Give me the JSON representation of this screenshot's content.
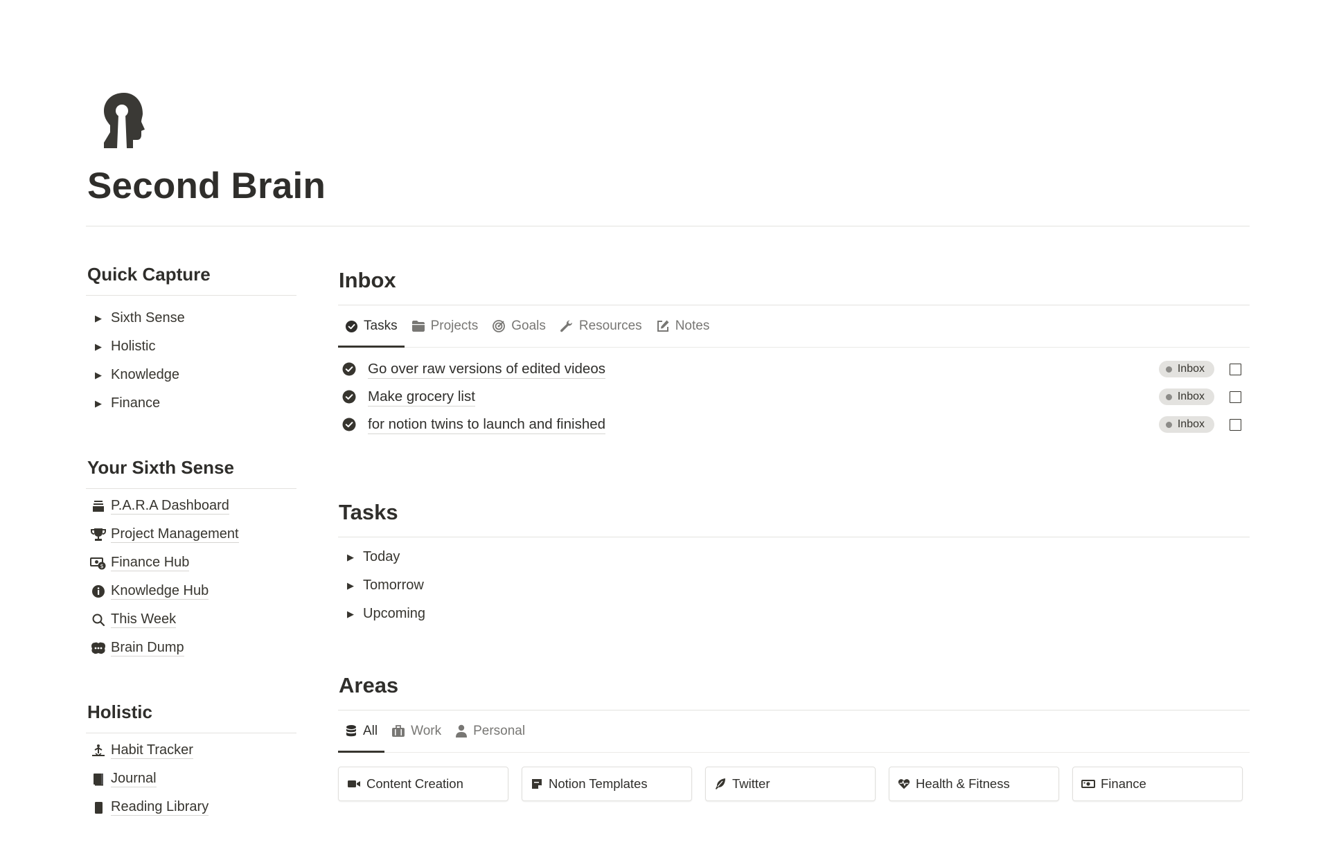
{
  "page": {
    "title": "Second Brain",
    "icon": "head-keyhole-icon"
  },
  "quick_capture": {
    "heading": "Quick Capture",
    "items": [
      {
        "label": "Sixth Sense"
      },
      {
        "label": "Holistic"
      },
      {
        "label": "Knowledge"
      },
      {
        "label": "Finance"
      }
    ]
  },
  "sixth_sense": {
    "heading": "Your Sixth Sense",
    "links": [
      {
        "label": "P.A.R.A Dashboard",
        "icon": "layers-icon"
      },
      {
        "label": "Project Management",
        "icon": "trophy-icon"
      },
      {
        "label": "Finance Hub",
        "icon": "money-icon"
      },
      {
        "label": "Knowledge Hub",
        "icon": "info-icon"
      },
      {
        "label": "This Week",
        "icon": "search-icon"
      },
      {
        "label": "Brain Dump",
        "icon": "brain-icon"
      }
    ]
  },
  "holistic": {
    "heading": "Holistic",
    "links": [
      {
        "label": "Habit Tracker",
        "icon": "habit-icon"
      },
      {
        "label": "Journal",
        "icon": "journal-icon"
      },
      {
        "label": "Reading Library",
        "icon": "bookmark-icon"
      }
    ]
  },
  "inbox": {
    "heading": "Inbox",
    "tabs": [
      {
        "label": "Tasks",
        "icon": "check-circle-icon",
        "active": true
      },
      {
        "label": "Projects",
        "icon": "folder-icon"
      },
      {
        "label": "Goals",
        "icon": "target-icon"
      },
      {
        "label": "Resources",
        "icon": "wrench-icon"
      },
      {
        "label": "Notes",
        "icon": "edit-icon"
      }
    ],
    "tasks": [
      {
        "title": "Go over raw versions of edited videos",
        "status": "Inbox",
        "done": false
      },
      {
        "title": "Make grocery list",
        "status": "Inbox",
        "done": false
      },
      {
        "title": "for notion twins to launch and finished",
        "status": "Inbox",
        "done": false
      }
    ]
  },
  "tasks_section": {
    "heading": "Tasks",
    "items": [
      {
        "label": "Today"
      },
      {
        "label": "Tomorrow"
      },
      {
        "label": "Upcoming"
      }
    ]
  },
  "areas": {
    "heading": "Areas",
    "tabs": [
      {
        "label": "All",
        "icon": "database-icon",
        "active": true
      },
      {
        "label": "Work",
        "icon": "briefcase-icon"
      },
      {
        "label": "Personal",
        "icon": "person-icon"
      }
    ],
    "cards": [
      {
        "label": "Content Creation",
        "icon": "video-icon"
      },
      {
        "label": "Notion Templates",
        "icon": "note-icon"
      },
      {
        "label": "Twitter",
        "icon": "feather-icon"
      },
      {
        "label": "Health & Fitness",
        "icon": "heart-pulse-icon"
      },
      {
        "label": "Finance",
        "icon": "cash-icon"
      }
    ]
  },
  "colors": {
    "text": "#37352f",
    "muted": "#787774",
    "divider": "#e3e2df",
    "pill_bg": "#e3e2df"
  }
}
